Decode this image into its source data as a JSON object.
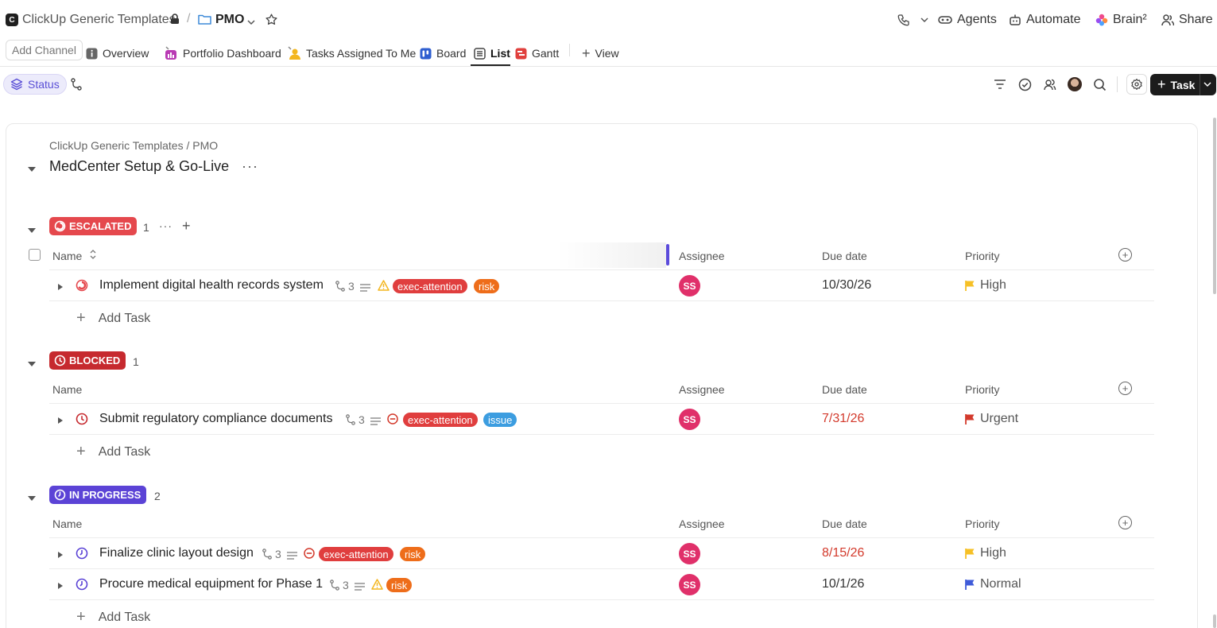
{
  "header": {
    "workspace_initial": "C",
    "workspace_name": "ClickUp Generic Templates",
    "separator": "/",
    "folder_name": "PMO",
    "right": {
      "agents": "Agents",
      "automate": "Automate",
      "brain": "Brain²",
      "share": "Share"
    }
  },
  "views": {
    "add_channel": "Add Channel",
    "tabs": [
      "Overview",
      "Portfolio Dashboard",
      "Tasks Assigned To Me",
      "Board",
      "List",
      "Gantt"
    ],
    "active_tab": "List",
    "add_view": "View"
  },
  "toolbar": {
    "group_by": "Status",
    "task_button": "Task",
    "task_plus": "+"
  },
  "list": {
    "breadcrumb": "ClickUp Generic Templates / PMO",
    "title": "MedCenter Setup & Go-Live",
    "more": "···"
  },
  "columns": {
    "name": "Name",
    "assignee": "Assignee",
    "due_date": "Due date",
    "priority": "Priority"
  },
  "add_task_label": "Add Task",
  "colors": {
    "escalated": "#e5484d",
    "blocked": "#c62a2f",
    "in_progress": "#5b43d6",
    "overdue": "#d33a2c",
    "avatar": "#e0306a"
  },
  "groups": [
    {
      "status": "ESCALATED",
      "count": "1",
      "color": "#e5484d",
      "tasks": [
        {
          "name": "Implement digital health records system",
          "subtasks": "3",
          "tags": [
            "exec-attention",
            "risk"
          ],
          "assignee": "SS",
          "due": "10/30/26",
          "priority": "High",
          "priority_color": "#f6c026"
        }
      ]
    },
    {
      "status": "BLOCKED",
      "count": "1",
      "color": "#c62a2f",
      "tasks": [
        {
          "name": "Submit regulatory compliance documents",
          "subtasks": "3",
          "tags": [
            "exec-attention",
            "issue"
          ],
          "assignee": "SS",
          "due": "7/31/26",
          "priority": "Urgent",
          "priority_color": "#d33a2c"
        }
      ]
    },
    {
      "status": "IN PROGRESS",
      "count": "2",
      "color": "#5b43d6",
      "tasks": [
        {
          "name": "Finalize clinic layout design",
          "subtasks": "3",
          "tags": [
            "exec-attention",
            "risk"
          ],
          "assignee": "SS",
          "due": "8/15/26",
          "priority": "High",
          "priority_color": "#f6c026"
        },
        {
          "name": "Procure medical equipment for Phase 1",
          "subtasks": "3",
          "tags": [
            "risk"
          ],
          "assignee": "SS",
          "due": "10/1/26",
          "priority": "Normal",
          "priority_color": "#3f5bd9"
        }
      ]
    }
  ]
}
